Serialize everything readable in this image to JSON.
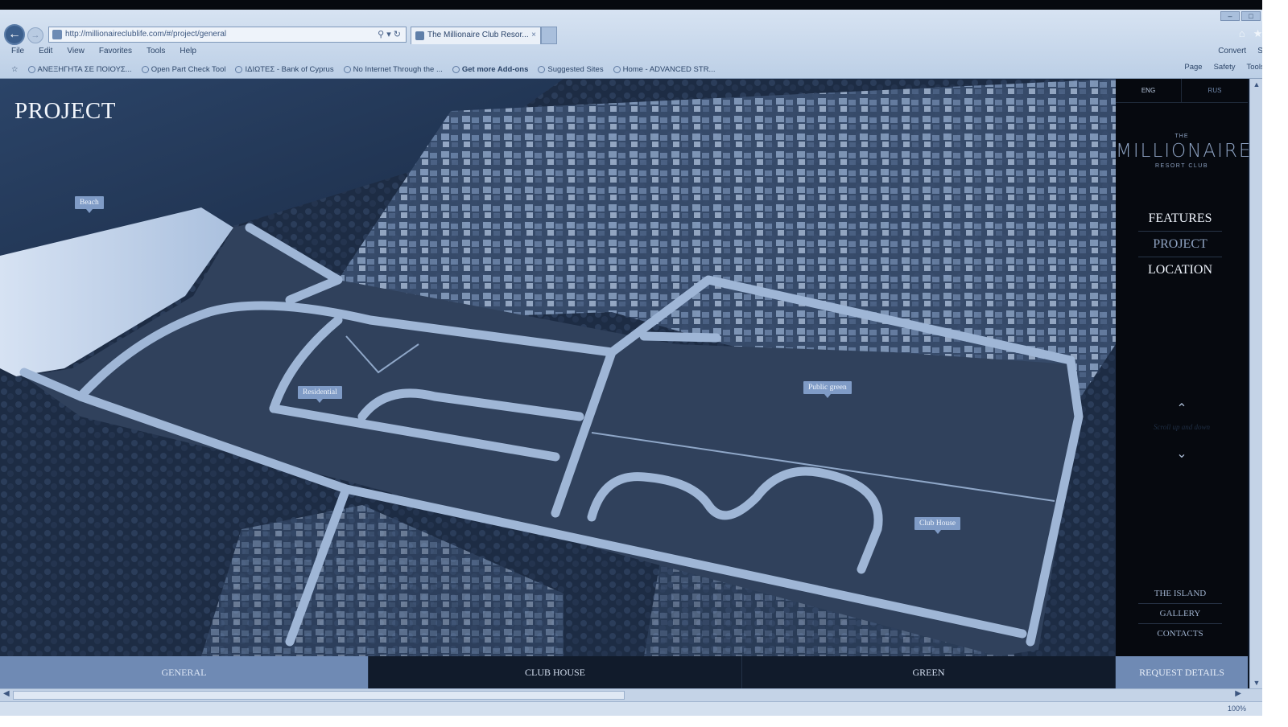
{
  "browser": {
    "url": "http://millionaireclublife.com/#/project/general",
    "tab_title": "The Millionaire Club Resor...",
    "menu": [
      "File",
      "Edit",
      "View",
      "Favorites",
      "Tools",
      "Help"
    ],
    "command_right": [
      "Convert",
      "Select"
    ],
    "favorites": [
      {
        "label": "ΑΝΕΞΗΓΗΤΑ ΣΕ ΠΟΙΟΥΣ...",
        "bold": false
      },
      {
        "label": "Open Part Check Tool",
        "bold": false
      },
      {
        "label": "ΙΔΙΩΤΕΣ - Bank of Cyprus",
        "bold": false
      },
      {
        "label": "No Internet Through the ...",
        "bold": false
      },
      {
        "label": "Get more Add-ons",
        "bold": true
      },
      {
        "label": "Suggested Sites",
        "bold": false
      },
      {
        "label": "Home - ADVANCED STR...",
        "bold": false
      }
    ],
    "toolbar_right": [
      "Page",
      "Safety",
      "Tools"
    ],
    "zoom": "100%"
  },
  "page": {
    "title": "PROJECT",
    "map_labels": {
      "beach": "Beach",
      "residential": "Residential",
      "public_green": "Public green",
      "club_house": "Club House"
    }
  },
  "side_panel": {
    "lang": [
      "ENG",
      "RUS"
    ],
    "logo": {
      "the": "THE",
      "main": "MILLIONAIRE",
      "sub": "RESORT CLUB"
    },
    "nav": [
      "FEATURES",
      "PROJECT",
      "LOCATION"
    ],
    "scroll_hint": "Scroll up and down",
    "footer_nav": [
      "THE ISLAND",
      "GALLERY",
      "CONTACTS"
    ]
  },
  "bottom_tabs": {
    "general": "GENERAL",
    "club_house": "CLUB HOUSE",
    "green": "GREEN",
    "request": "REQUEST DETAILS"
  }
}
